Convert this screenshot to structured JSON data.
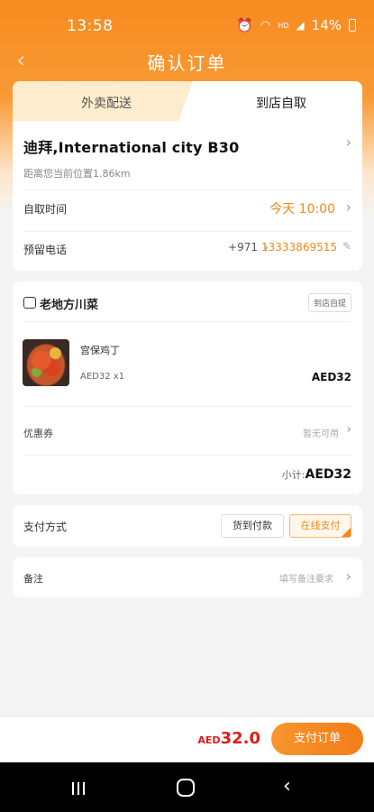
{
  "status_bar": {
    "time": "13:58",
    "battery": "14%",
    "icons": [
      "alarm-icon",
      "wifi-icon",
      "hd-icon",
      "signal-icon",
      "battery-icon"
    ]
  },
  "header": {
    "title": "确认订单",
    "back_icon": "chevron-left-icon"
  },
  "tabs": {
    "delivery": "外卖配送",
    "pickup": "到店自取",
    "active": "pickup"
  },
  "pickup": {
    "store_name": "迪拜,International city B30",
    "distance": "距离您当前位置1.86km",
    "time_label": "自取时间",
    "time_value": "今天 10:00",
    "phone_label": "预留电话",
    "phone_code": "+971",
    "phone_number": "13333869515"
  },
  "order": {
    "shop_name": "老地方川菜",
    "mode_badge": "到店自提",
    "items": [
      {
        "name": "宫保鸡丁",
        "price": "AED32",
        "qty": "x1",
        "total": "AED32"
      }
    ],
    "coupon_label": "优惠券",
    "coupon_value": "暂无可用",
    "subtotal_label": "小计:",
    "subtotal_value": "AED32"
  },
  "payment": {
    "label": "支付方式",
    "cod": "货到付款",
    "online": "在线支付",
    "selected": "online"
  },
  "note": {
    "label": "备注",
    "placeholder": "填写备注要求"
  },
  "footer": {
    "currency": "AED",
    "amount": "32.0",
    "submit": "支付订单"
  },
  "colors": {
    "accent": "#f08a18",
    "price_red": "#e11b1b",
    "tab_bg": "#fdeccd"
  }
}
